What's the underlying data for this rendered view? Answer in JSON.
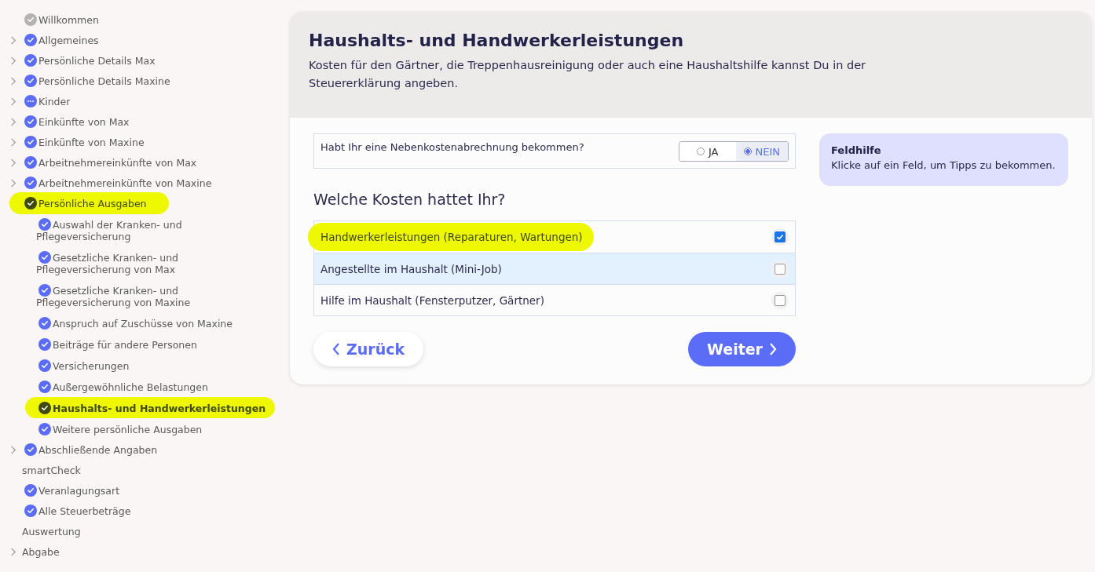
{
  "sidebar": {
    "items": [
      {
        "label": "Willkommen",
        "kind": "inactive",
        "expandable": false,
        "highlighted": false,
        "selected": false
      },
      {
        "label": "Allgemeines",
        "kind": "done",
        "expandable": true,
        "expanded": false,
        "highlighted": false,
        "selected": false
      },
      {
        "label": "Persönliche Details Max",
        "kind": "done",
        "expandable": true,
        "expanded": false,
        "highlighted": false,
        "selected": false
      },
      {
        "label": "Persönliche Details Maxine",
        "kind": "done",
        "expandable": true,
        "expanded": false,
        "highlighted": false,
        "selected": false
      },
      {
        "label": "Kinder",
        "kind": "pending",
        "expandable": true,
        "expanded": false,
        "highlighted": false,
        "selected": false
      },
      {
        "label": "Einkünfte von Max",
        "kind": "done",
        "expandable": true,
        "expanded": false,
        "highlighted": false,
        "selected": false
      },
      {
        "label": "Einkünfte von Maxine",
        "kind": "done",
        "expandable": true,
        "expanded": false,
        "highlighted": false,
        "selected": false
      },
      {
        "label": "Arbeitnehmereinkünfte von Max",
        "kind": "done",
        "expandable": true,
        "expanded": false,
        "highlighted": false,
        "selected": false
      },
      {
        "label": "Arbeitnehmereinkünfte von Maxine",
        "kind": "done",
        "expandable": true,
        "expanded": false,
        "highlighted": false,
        "selected": false
      },
      {
        "label": "Persönliche Ausgaben",
        "kind": "done",
        "expandable": true,
        "expanded": true,
        "highlighted": true,
        "selected": false,
        "children": [
          {
            "label": "Auswahl der Kranken- und Pflegeversicherung",
            "kind": "done",
            "highlighted": false,
            "selected": false
          },
          {
            "label": "Gesetzliche Kranken- und Pflegeversicherung von Max",
            "kind": "done",
            "highlighted": false,
            "selected": false
          },
          {
            "label": "Gesetzliche Kranken- und Pflegeversicherung von Maxine",
            "kind": "done",
            "highlighted": false,
            "selected": false
          },
          {
            "label": "Anspruch auf Zuschüsse von Maxine",
            "kind": "done",
            "highlighted": false,
            "selected": false
          },
          {
            "label": "Beiträge für andere Personen",
            "kind": "done",
            "highlighted": false,
            "selected": false
          },
          {
            "label": "Versicherungen",
            "kind": "done",
            "highlighted": false,
            "selected": false
          },
          {
            "label": "Außergewöhnliche Belastungen",
            "kind": "done",
            "highlighted": false,
            "selected": false
          },
          {
            "label": "Haushalts- und Handwerkerleistungen",
            "kind": "done",
            "highlighted": true,
            "selected": true
          },
          {
            "label": "Weitere persönliche Ausgaben",
            "kind": "done",
            "highlighted": false,
            "selected": false
          }
        ]
      },
      {
        "label": "Abschließende Angaben",
        "kind": "done",
        "expandable": true,
        "expanded": false,
        "highlighted": false,
        "selected": false
      },
      {
        "label": "smartCheck",
        "kind": "plain",
        "expandable": false,
        "highlighted": false,
        "selected": false
      },
      {
        "label": "Veranlagungsart",
        "kind": "done",
        "expandable": false,
        "highlighted": false,
        "selected": false
      },
      {
        "label": "Alle Steuerbeträge",
        "kind": "done",
        "expandable": false,
        "highlighted": false,
        "selected": false
      },
      {
        "label": "Auswertung",
        "kind": "plain",
        "expandable": false,
        "highlighted": false,
        "selected": false
      },
      {
        "label": "Abgabe",
        "kind": "plain",
        "expandable": true,
        "expanded": false,
        "highlighted": false,
        "selected": false
      }
    ]
  },
  "page": {
    "title": "Haushalts- und Handwerkerleistungen",
    "intro": "Kosten für den Gärtner, die Treppenhausreinigung oder auch eine Haushaltshilfe kannst Du in der Steuererklärung angeben."
  },
  "question": {
    "label": "Habt Ihr eine Nebenkostenabrechnung bekommen?",
    "options": [
      {
        "label": "JA",
        "selected": false
      },
      {
        "label": "NEIN",
        "selected": true
      }
    ]
  },
  "field_help": {
    "title": "Feldhilfe",
    "text": "Klicke auf ein Feld, um Tipps zu bekommen."
  },
  "costs": {
    "heading": "Welche Kosten hattet Ihr?",
    "options": [
      {
        "label": "Handwerkerleistungen (Reparaturen, Wartungen)",
        "checked": true,
        "highlighted": true,
        "hovered": false
      },
      {
        "label": "Angestellte im Haushalt (Mini-Job)",
        "checked": false,
        "highlighted": false,
        "hovered": true
      },
      {
        "label": "Hilfe im Haushalt (Fensterputzer, Gärtner)",
        "checked": false,
        "highlighted": false,
        "hovered": false
      }
    ]
  },
  "buttons": {
    "back": "Zurück",
    "next": "Weiter"
  }
}
